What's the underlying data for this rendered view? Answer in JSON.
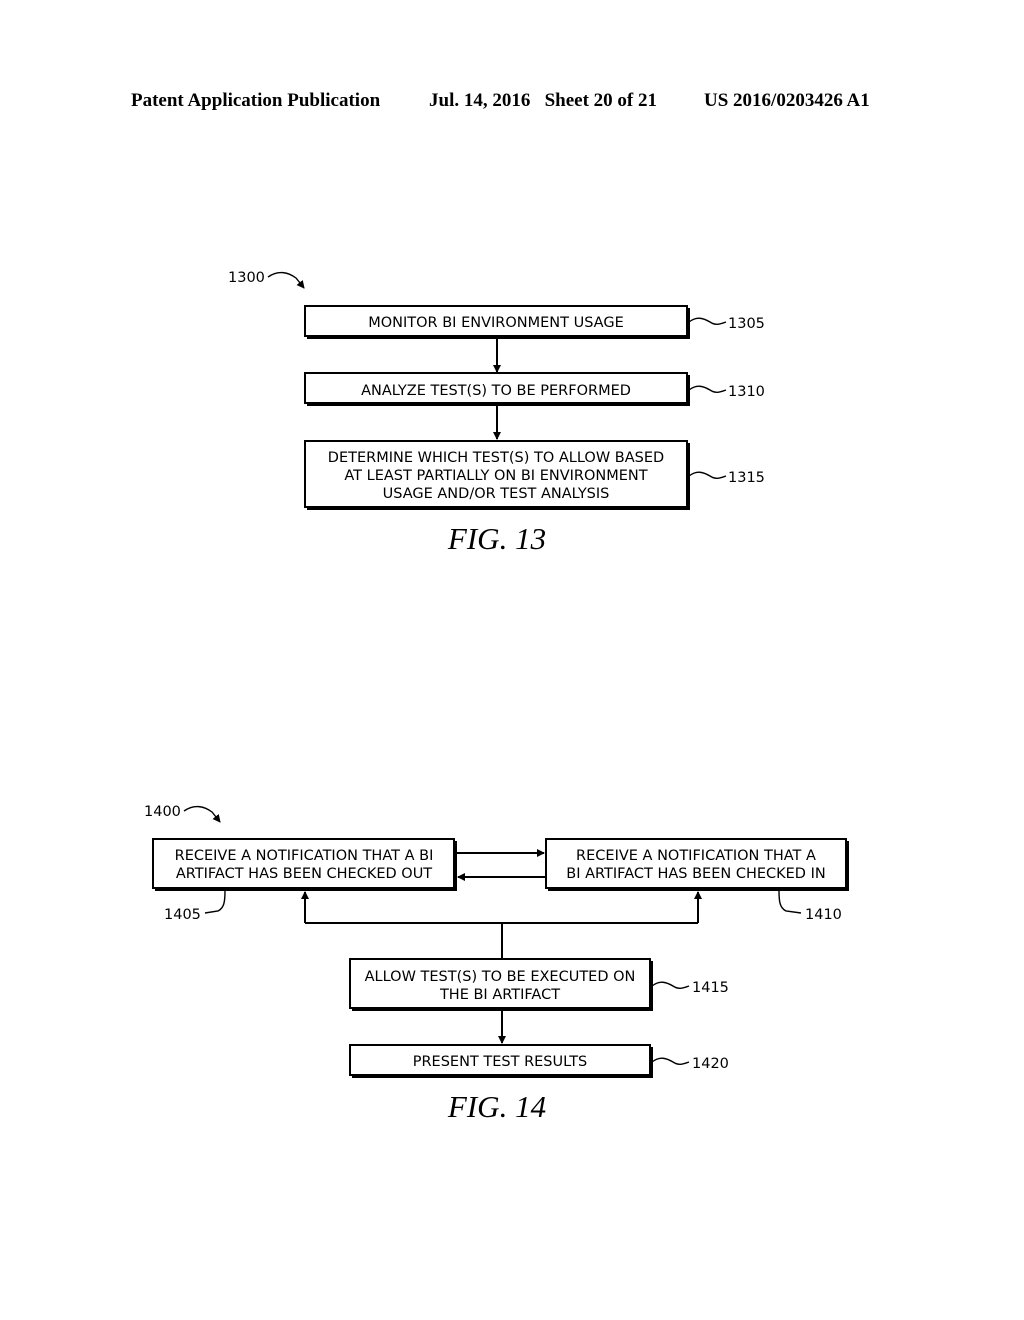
{
  "header": {
    "publication": "Patent Application Publication",
    "date_sheet": "Jul. 14, 2016   Sheet 20 of 21",
    "patent_number": "US 2016/0203426 A1"
  },
  "fig13": {
    "ref": "1300",
    "caption": "FIG. 13",
    "steps": [
      {
        "ref": "1305",
        "lines": [
          "MONITOR BI ENVIRONMENT USAGE"
        ]
      },
      {
        "ref": "1310",
        "lines": [
          "ANALYZE TEST(S) TO BE PERFORMED"
        ]
      },
      {
        "ref": "1315",
        "lines": [
          "DETERMINE WHICH TEST(S) TO ALLOW BASED",
          "AT LEAST PARTIALLY ON BI ENVIRONMENT",
          "USAGE AND/OR TEST ANALYSIS"
        ]
      }
    ]
  },
  "fig14": {
    "ref": "1400",
    "caption": "FIG. 14",
    "steps": [
      {
        "ref": "1405",
        "lines": [
          "RECEIVE A NOTIFICATION THAT A BI",
          "ARTIFACT HAS BEEN CHECKED OUT"
        ]
      },
      {
        "ref": "1410",
        "lines": [
          "RECEIVE A NOTIFICATION THAT A",
          "BI ARTIFACT HAS BEEN CHECKED IN"
        ]
      },
      {
        "ref": "1415",
        "lines": [
          "ALLOW TEST(S) TO BE EXECUTED ON",
          "THE BI ARTIFACT"
        ]
      },
      {
        "ref": "1420",
        "lines": [
          "PRESENT TEST RESULTS"
        ]
      }
    ]
  }
}
